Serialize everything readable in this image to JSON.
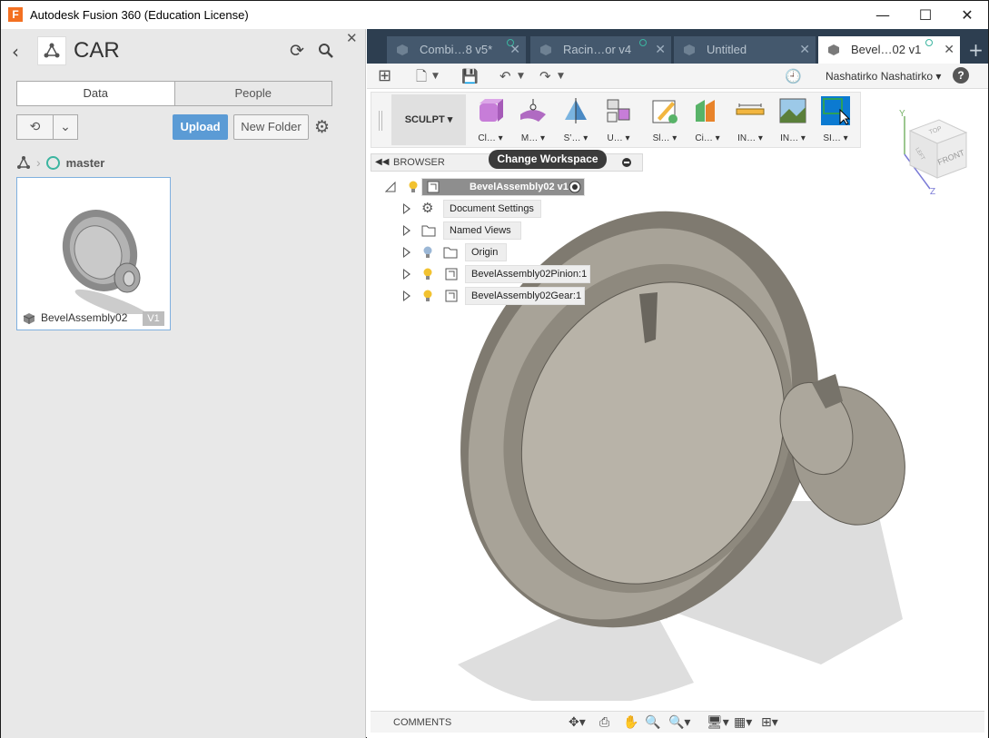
{
  "window": {
    "title": "Autodesk Fusion 360 (Education License)",
    "app_icon_letter": "F",
    "minimize_glyph": "—",
    "maximize_glyph": "☐",
    "close_glyph": "✕"
  },
  "data_panel": {
    "back_glyph": "‹",
    "project_title": "CAR",
    "refresh_glyph": "⟳",
    "close_glyph": "✕",
    "tabs": {
      "data": "Data",
      "people": "People"
    },
    "history_glyph": "⟲",
    "chevron_glyph": "⌄",
    "upload_label": "Upload",
    "new_folder_label": "New Folder",
    "gear_glyph": "⚙",
    "breadcrumb": {
      "sep": "›",
      "branch": "master"
    },
    "file_card": {
      "name": "BevelAssembly02",
      "version": "V1"
    }
  },
  "doc_tabs": [
    {
      "label": "Combi…8 v5*",
      "close": "✕"
    },
    {
      "label": "Racin…or v4",
      "close": "✕"
    },
    {
      "label": "Untitled",
      "close": "✕"
    },
    {
      "label": "Bevel…02 v1",
      "close": "✕"
    }
  ],
  "doc_tab_add": "+",
  "quick_access": {
    "grid_glyph": "⊞",
    "file_glyph": "🗋",
    "save_glyph": "💾",
    "undo_glyph": "↶",
    "redo_glyph": "↷",
    "history_glyph": "🕘",
    "user_name": "Nashatirko Nashatirko ▾",
    "help_glyph": "?"
  },
  "ribbon": {
    "workspace": "SCULPT ▾",
    "tools": [
      {
        "label": "Cl… ▾"
      },
      {
        "label": "M… ▾"
      },
      {
        "label": "S’… ▾"
      },
      {
        "label": "U… ▾"
      },
      {
        "label": "Sl… ▾"
      },
      {
        "label": "Ci… ▾"
      },
      {
        "label": "IN… ▾"
      },
      {
        "label": "IN… ▾"
      },
      {
        "label": "SI… ▾"
      }
    ]
  },
  "browser": {
    "collapse_glyph": "◀◀",
    "label": "BROWSER",
    "tooltip": "Change Workspace",
    "root": "BevelAssembly02 v1",
    "items": [
      {
        "label": "Document Settings"
      },
      {
        "label": "Named Views"
      },
      {
        "label": "Origin"
      },
      {
        "label": "BevelAssembly02Pinion:1"
      },
      {
        "label": "BevelAssembly02Gear:1"
      }
    ]
  },
  "viewcube": {
    "top": "TOP",
    "front": "FRONT",
    "left": "LEFT",
    "y": "Y",
    "z": "Z"
  },
  "bottom": {
    "comments": "COMMENTS",
    "nav_icons": [
      "✥▾",
      "⎙",
      "✋",
      "🔍",
      "🔍▾",
      "🖥▾",
      "▦▾",
      "⊞▾"
    ]
  },
  "colors": {
    "accent": "#5b9bd5",
    "tabbar": "#2d3e50",
    "selected_tool": "#0b7ad1",
    "teal": "#3bb5a0"
  }
}
